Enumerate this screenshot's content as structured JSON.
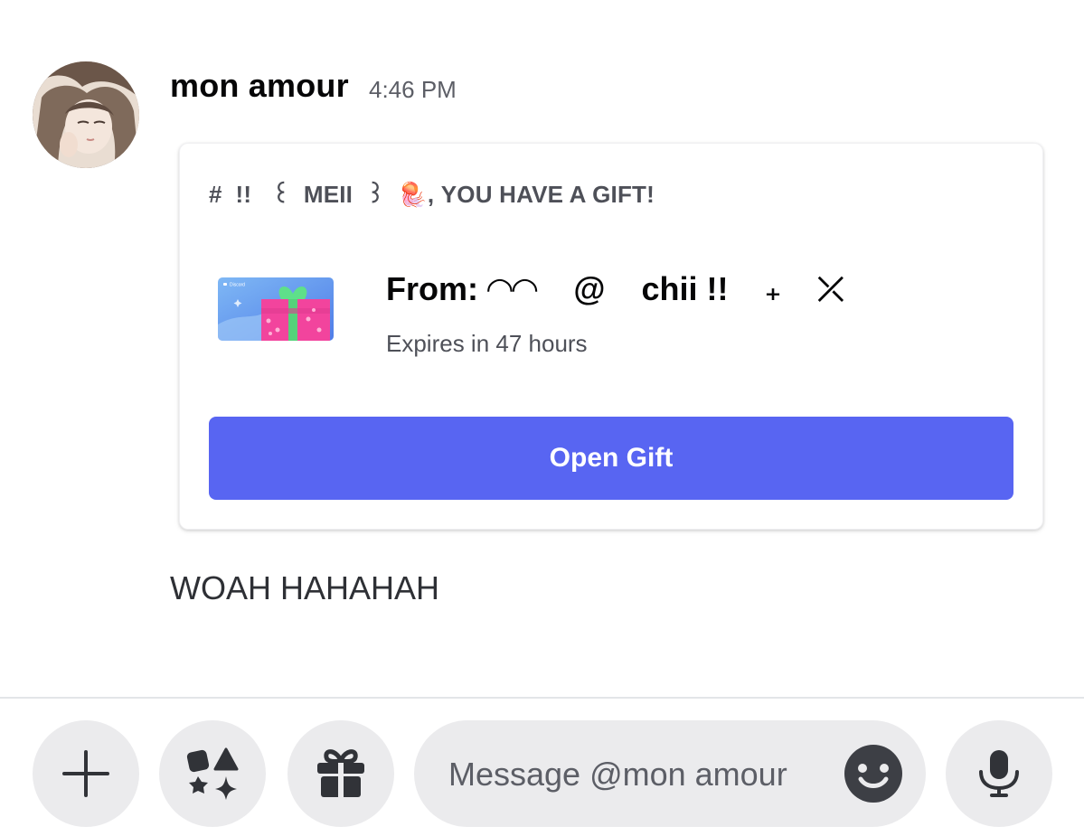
{
  "message": {
    "author": "mon amour",
    "timestamp": "4:46 PM",
    "text": "WOAH HAHAHAH"
  },
  "gift": {
    "header": "#  !!   ꒰  MEII  ꒱  🪼, YOU HAVE A GIFT!",
    "thumbnail_label": "Discord",
    "from": "From: ◠◠    @    chii !!    ₊    ⤫",
    "expires": "Expires in 47 hours",
    "button_label": "Open Gift"
  },
  "composer": {
    "placeholder": "Message @mon amour",
    "buttons": [
      "plus-icon",
      "apps-icon",
      "gift-icon",
      "emoji-icon",
      "microphone-icon"
    ]
  },
  "colors": {
    "blurple": "#5865f2",
    "button_bg": "#ebebed",
    "icon_dark": "#313338"
  }
}
